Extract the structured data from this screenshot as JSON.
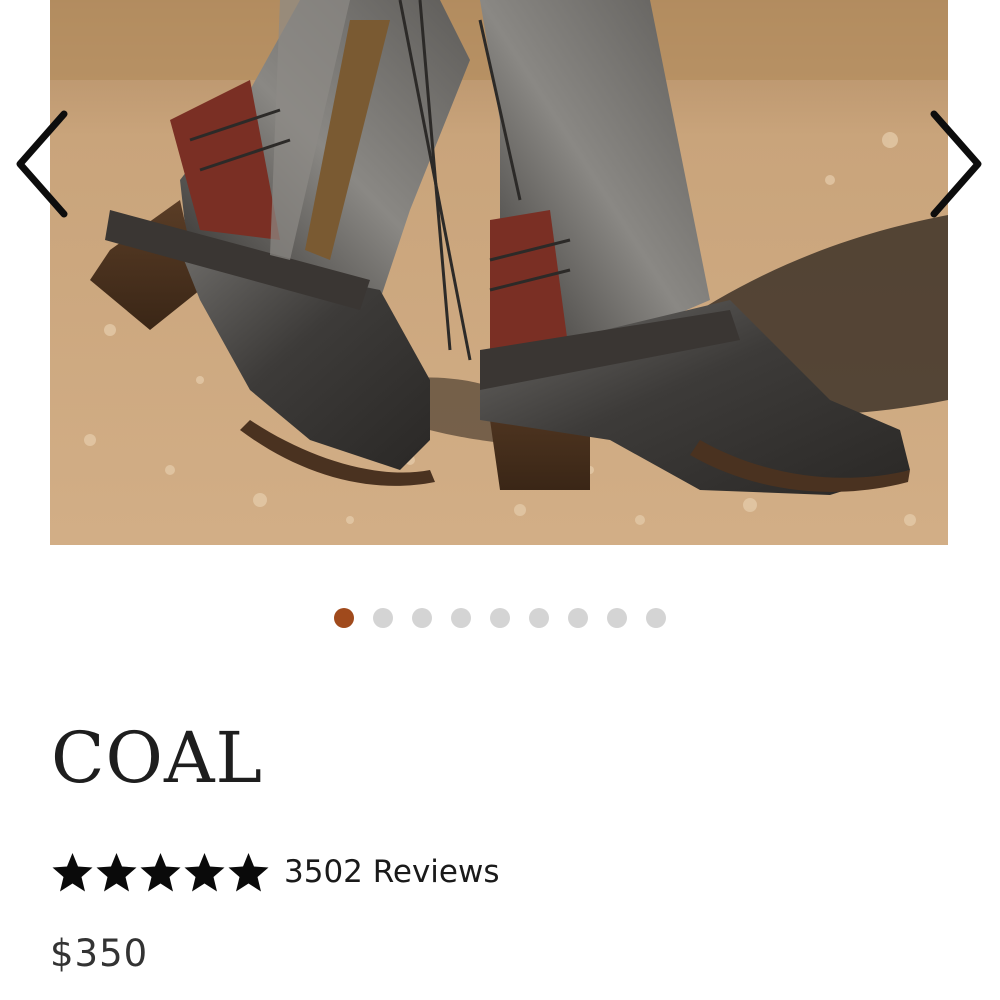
{
  "carousel": {
    "image_subject": "boots-photo",
    "prev_icon": "chevron-left-icon",
    "next_icon": "chevron-right-icon",
    "current_index": 1,
    "total_images": 9,
    "active_dot_color": "#a04a1c",
    "inactive_dot_color": "#d4d4d4"
  },
  "product": {
    "title": "COAL",
    "rating": {
      "stars": 5,
      "max_stars": 5,
      "star_icon": "star-icon",
      "reviews_label": "3502 Reviews"
    },
    "price": "$350"
  }
}
